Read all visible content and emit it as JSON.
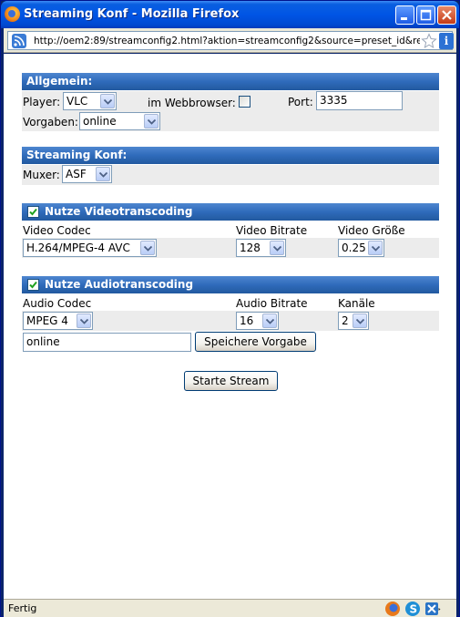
{
  "window": {
    "title": "Streaming Konf - Mozilla Firefox",
    "url": "http://oem2:89/streamconfig2.html?aktion=streamconfig2&source=preset_id&recid=&c"
  },
  "general": {
    "header": "Allgemein:",
    "player_label": "Player:",
    "player_value": "VLC",
    "webbrowser_label": "im Webbrowser:",
    "webbrowser_checked": false,
    "port_label": "Port:",
    "port_value": "3335",
    "presets_label": "Vorgaben:",
    "presets_value": "online"
  },
  "streaming": {
    "header": "Streaming Konf:",
    "muxer_label": "Muxer:",
    "muxer_value": "ASF"
  },
  "video": {
    "header": "Nutze Videotranscoding",
    "enabled": true,
    "codec_label": "Video Codec",
    "codec_value": "H.264/MPEG-4 AVC",
    "bitrate_label": "Video Bitrate",
    "bitrate_value": "128",
    "size_label": "Video Größe",
    "size_value": "0.25"
  },
  "audio": {
    "header": "Nutze Audiotranscoding",
    "enabled": true,
    "codec_label": "Audio Codec",
    "codec_value": "MPEG 4",
    "bitrate_label": "Audio Bitrate",
    "bitrate_value": "16",
    "channels_label": "Kanäle",
    "channels_value": "2"
  },
  "preset_save": {
    "input_value": "online",
    "button_label": "Speichere Vorgabe"
  },
  "start_button": "Starte Stream",
  "status": {
    "text": "Fertig"
  },
  "colors": {
    "section_header": "#2f6bbb",
    "titlebar": "#0055e5",
    "row_background": "#ececec"
  }
}
